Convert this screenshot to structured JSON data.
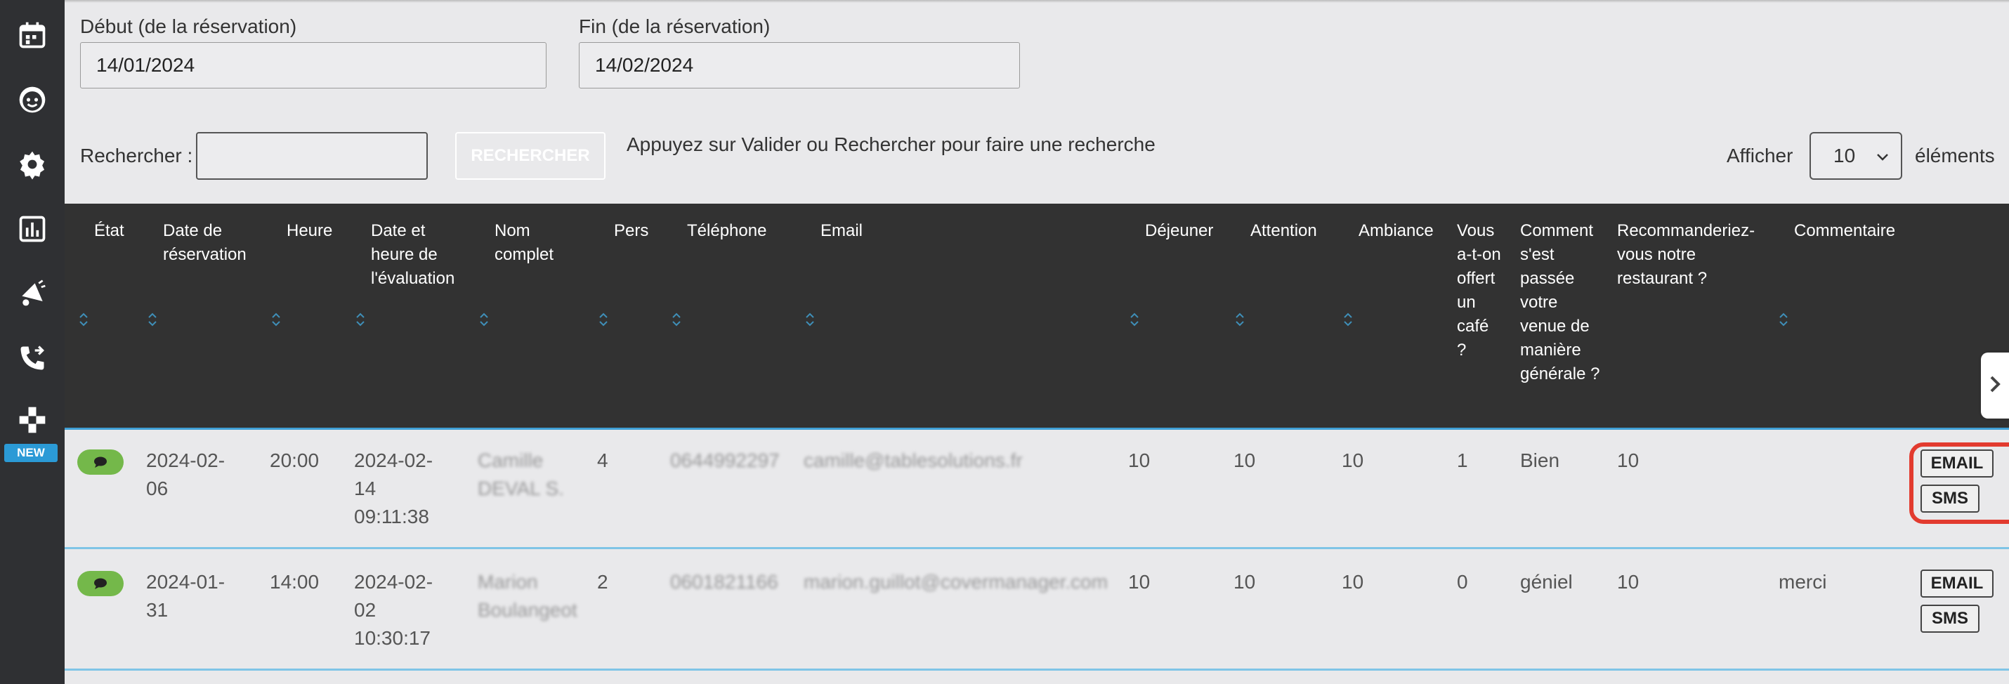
{
  "sidebar": {
    "items": [
      {
        "icon": "calendar-icon"
      },
      {
        "icon": "smiley-icon"
      },
      {
        "icon": "gear-icon"
      },
      {
        "icon": "bar-chart-icon"
      },
      {
        "icon": "megaphone-icon"
      },
      {
        "icon": "phone-transfer-icon"
      },
      {
        "icon": "gamepad-icon"
      }
    ],
    "new_badge": "NEW"
  },
  "filters": {
    "start_label": "Début (de la réservation)",
    "start_value": "14/01/2024",
    "end_label": "Fin (de la réservation)",
    "end_value": "14/02/2024",
    "search_label": "Rechercher :",
    "search_value": "",
    "search_button": "RECHERCHER",
    "hint": "Appuyez sur Valider ou Rechercher pour faire une recherche",
    "show_label": "Afficher",
    "page_size": "10",
    "elements_label": "éléments"
  },
  "table": {
    "headers": [
      "État",
      "Date de réservation",
      "Heure",
      "Date et heure de l'évaluation",
      "Nom complet",
      "Pers",
      "Téléphone",
      "Email",
      "Déjeuner",
      "Attention",
      "Ambiance",
      "Vous a-t-on offert un café ?",
      "Comment s'est passée votre venue de manière générale ?",
      "Recommanderiez-vous notre restaurant ?",
      "Commentaire"
    ],
    "rows": [
      {
        "date": "2024-02-06",
        "heure": "20:00",
        "eval": "2024-02-14 09:11:38",
        "nom": "Camille DEVAL S.",
        "pers": "4",
        "tel": "0644992297",
        "email": "camille@tablesolutions.fr",
        "dejeuner": "10",
        "attention": "10",
        "ambiance": "10",
        "cafe": "1",
        "venue": "Bien",
        "recommande": "10",
        "commentaire": "",
        "email_btn": "EMAIL",
        "sms_btn": "SMS"
      },
      {
        "date": "2024-01-31",
        "heure": "14:00",
        "eval": "2024-02-02 10:30:17",
        "nom": "Marion Boulangeot",
        "pers": "2",
        "tel": "0601821166",
        "email": "marion.guillot@covermanager.com",
        "dejeuner": "10",
        "attention": "10",
        "ambiance": "10",
        "cafe": "0",
        "venue": "géniel",
        "recommande": "10",
        "commentaire": "merci",
        "email_btn": "EMAIL",
        "sms_btn": "SMS"
      }
    ]
  },
  "colors": {
    "sidebar_bg": "#2f3033",
    "header_bg": "#323232",
    "accent_blue": "#3f9fd6",
    "badge_green": "#74b84a",
    "highlight_red": "#e23b2f",
    "new_badge_bg": "#2b9ad6"
  }
}
